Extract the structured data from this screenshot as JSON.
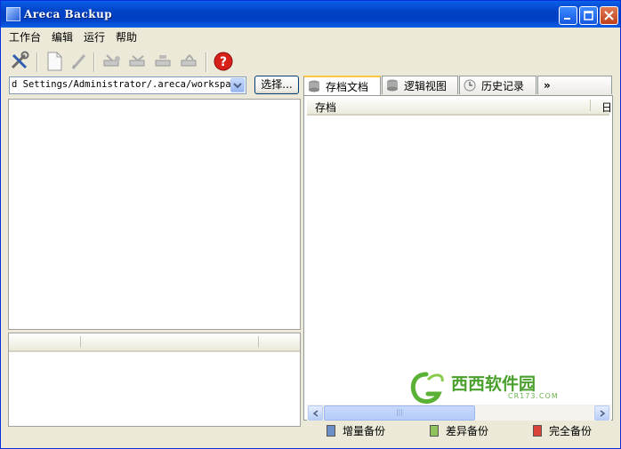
{
  "window": {
    "title": "Areca Backup"
  },
  "menu": [
    "工作台",
    "编辑",
    "运行",
    "帮助"
  ],
  "workspace": {
    "path": "d Settings/Administrator/.areca/workspace",
    "choose_label": "选择..."
  },
  "tabs": [
    {
      "label": "存档文档",
      "icon": "database-icon"
    },
    {
      "label": "逻辑视图",
      "icon": "database-icon"
    },
    {
      "label": "历史记录",
      "icon": "clock-icon"
    },
    {
      "label": "»",
      "icon": "overflow-icon"
    }
  ],
  "archive_table": {
    "columns": [
      "存档",
      "日"
    ]
  },
  "legend": [
    {
      "label": "增量备份",
      "color": "#6C8FC7"
    },
    {
      "label": "差异备份",
      "color": "#8FC25A"
    },
    {
      "label": "完全备份",
      "color": "#D9443A"
    }
  ],
  "watermark": {
    "text": "西西软件园",
    "sub": "CR173.COM",
    "color": "#4AA02C"
  }
}
